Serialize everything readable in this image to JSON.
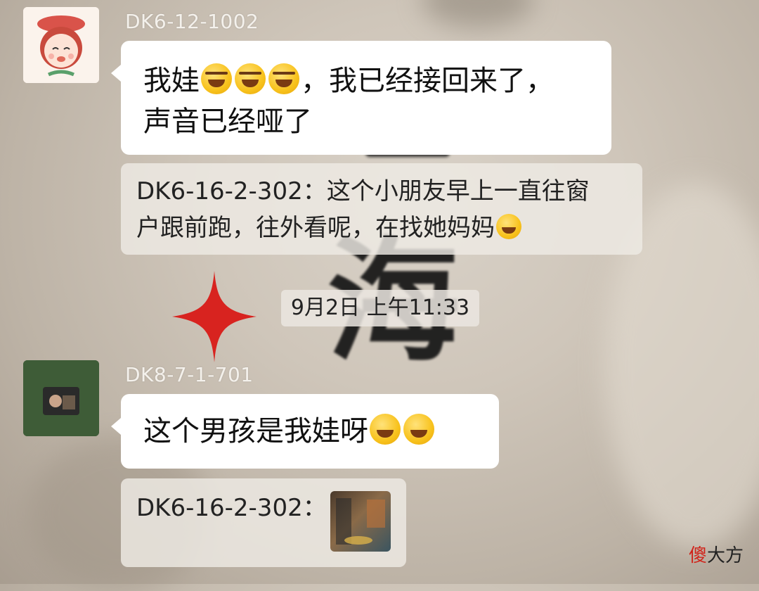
{
  "messages": [
    {
      "sender": "DK6-12-1002",
      "text_before": "我娃",
      "emoji": [
        "face-palm-emoji",
        "face-palm-emoji",
        "face-palm-emoji"
      ],
      "text_after_line1": "，我已经接回来了，",
      "text_line2": "声音已经哑了"
    },
    {
      "quote_line1": "DK6-16-2-302：这个小朋友早上一直往窗",
      "quote_line2": "户跟前跑，往外看呢，在找她妈妈",
      "emoji": "tears-of-joy-emoji"
    },
    {
      "timestamp": "9月2日 上午11:33"
    },
    {
      "sender": "DK8-7-1-701",
      "text": "这个男孩是我娃呀",
      "emoji": [
        "tears-of-joy-emoji",
        "tears-of-joy-emoji"
      ]
    },
    {
      "quote_sender": "DK6-16-2-302：",
      "attachment": "image-thumbnail"
    }
  ],
  "watermark": {
    "first": "傻",
    "rest": "大方"
  },
  "colors": {
    "bubble": "#ffffff",
    "quote": "#eeeae4",
    "sender": "#f4f1ec",
    "star": "#d8231f",
    "watermark_accent": "#d0231a"
  }
}
